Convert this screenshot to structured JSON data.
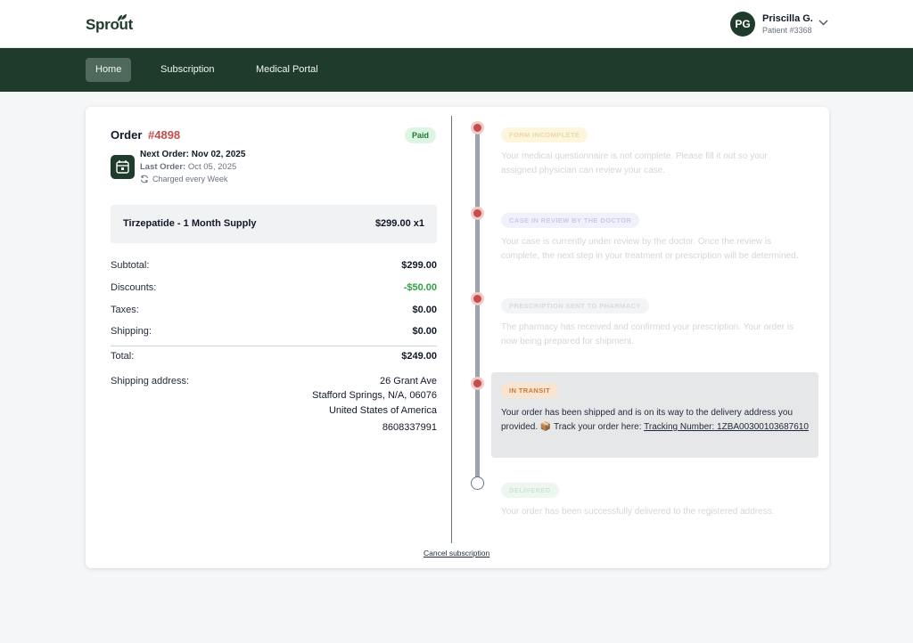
{
  "header": {
    "logo": "Sprout",
    "user": {
      "initials": "PG",
      "name": "Priscilla G.",
      "patient_id": "Patient #3368"
    }
  },
  "nav": {
    "items": [
      {
        "label": "Home",
        "active": true
      },
      {
        "label": "Subscription",
        "active": false
      },
      {
        "label": "Medical Portal",
        "active": false
      }
    ]
  },
  "order": {
    "title": "Order",
    "number": "#4898",
    "status": "Paid",
    "next_order_label": "Next Order:",
    "next_order_date": "Nov 02, 2025",
    "last_order_label": "Last Order:",
    "last_order_date": "Oct 05, 2025",
    "frequency": "Charged every Week",
    "product": {
      "name": "Tirzepatide - 1 Month Supply",
      "price": "$299.00 x1"
    },
    "summary": [
      {
        "label": "Subtotal:",
        "value": "$299.00"
      },
      {
        "label": "Discounts:",
        "value": "-$50.00"
      },
      {
        "label": "Taxes:",
        "value": "$0.00"
      },
      {
        "label": "Shipping:",
        "value": "$0.00"
      }
    ],
    "total_label": "Total:",
    "total_value": "$249.00",
    "shipping_label": "Shipping address:",
    "address": [
      "26 Grant Ave",
      "Stafford Springs, N/A, 06076",
      "United States of America",
      "8608337991"
    ],
    "cancel": "Cancel subscription"
  },
  "timeline": [
    {
      "badge": "FORM INCOMPLETE",
      "text": "Your medical questionnaire is not complete. Please fill it out so your assigned physician can review your case.",
      "state": "done"
    },
    {
      "badge": "CASE IN REVIEW BY THE DOCTOR",
      "text": "Your case is currently under review by the doctor. Once the review is complete, the next step in your treatment or prescription will be determined.",
      "state": "done"
    },
    {
      "badge": "PRESCRIPTION SENT TO PHARMACY",
      "text": "The pharmacy has received and confirmed your prescription. Your order is now being prepared for shipment.",
      "state": "done"
    },
    {
      "badge": "IN TRANSIT",
      "text": "Your order has been shipped and is on its way to the delivery address you provided. 📦 Track your order here:",
      "link_label": "Tracking Number:",
      "tracking": "1ZBA00300103687610",
      "state": "current"
    },
    {
      "badge": "DELIVERED",
      "text": "Your order has been successfully delivered to the registered address.",
      "state": "pending"
    }
  ],
  "colors": {
    "brand": "#1e3b2c",
    "accent": "#c0504d",
    "paid_bg": "#dff5e3",
    "discount": "#2f9e44"
  }
}
